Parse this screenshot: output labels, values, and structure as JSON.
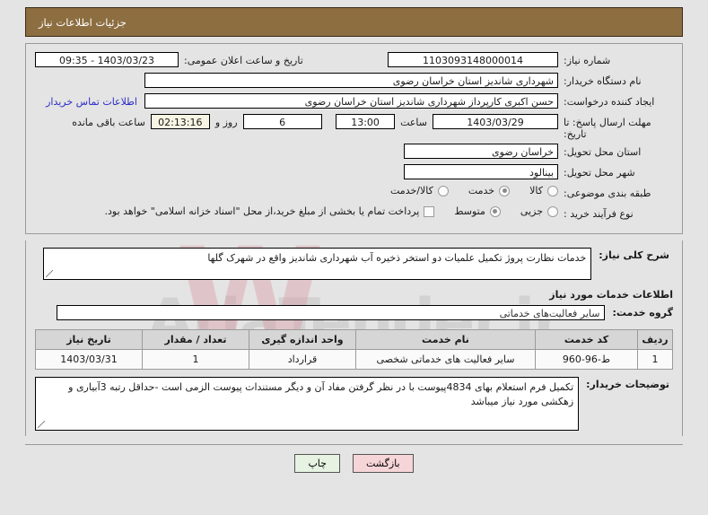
{
  "header": {
    "title": "جزئیات اطلاعات نیاز",
    "bar_color": "#8d6e41"
  },
  "watermark": {
    "text": "AriaTender.ir",
    "mark": "W"
  },
  "form": {
    "need_number": {
      "label": "شماره نیاز:",
      "value": "1103093148000014"
    },
    "public_announce": {
      "label": "تاریخ و ساعت اعلان عمومی:",
      "value": "1403/03/23 - 09:35"
    },
    "buyer_org": {
      "label": "نام دستگاه خریدار:",
      "value": "شهرداری شاندیز استان خراسان رضوی"
    },
    "requester": {
      "label": "ایجاد کننده درخواست:",
      "value": "حسن اکبری کارپرداز شهرداری شاندیز استان خراسان رضوی"
    },
    "contact_link": "اطلاعات تماس خریدار",
    "deadline": {
      "label": "مهلت ارسال پاسخ: تا تاریخ:",
      "date": "1403/03/29",
      "time_label": "ساعت",
      "time": "13:00",
      "days": "6",
      "days_sep": "روز و",
      "countdown": "02:13:16",
      "remaining_label": "ساعت باقی مانده"
    },
    "province": {
      "label": "استان محل تحویل:",
      "value": "خراسان رضوی"
    },
    "city": {
      "label": "شهر محل تحویل:",
      "value": "بینالود"
    },
    "classification": {
      "label": "طبقه بندی موضوعی:",
      "options": [
        {
          "label": "کالا",
          "selected": false
        },
        {
          "label": "خدمت",
          "selected": true
        },
        {
          "label": "کالا/خدمت",
          "selected": false
        }
      ]
    },
    "process_type": {
      "label": "نوع فرآیند خرید :",
      "options": [
        {
          "label": "جزیی",
          "selected": false
        },
        {
          "label": "متوسط",
          "selected": true
        }
      ],
      "checkbox_checked": false,
      "payment_note": "پرداخت تمام یا بخشی از مبلغ خرید،از محل \"اسناد خزانه اسلامی\" خواهد بود."
    }
  },
  "need_description": {
    "label": "شرح کلی نیاز:",
    "value": "خدمات نظارت پروژ تکمیل علمیات دو استخر  ذخیره آب شهرداری شاندیز واقع در شهرک گلها"
  },
  "services_section": {
    "heading": "اطلاعات خدمات مورد نیاز",
    "service_group": {
      "label": "گروه خدمت:",
      "value": "سایر فعالیت‌های خدماتی"
    }
  },
  "items_table": {
    "columns": [
      "ردیف",
      "کد خدمت",
      "نام خدمت",
      "واحد اندازه گیری",
      "تعداد / مقدار",
      "تاریخ نیاز"
    ],
    "rows": [
      {
        "row": "1",
        "code": "ط-96-960",
        "name": "سایر فعالیت های خدماتی شخصی",
        "unit": "قرارداد",
        "qty": "1",
        "date": "1403/03/31"
      }
    ]
  },
  "buyer_notes": {
    "label": "توضیحات خریدار:",
    "value": "تکمیل فرم استعلام بهای 4834پیوست با در نظر گرفتن مفاد آن و دیگر مستندات پیوست الزمی است -حداقل رتبه 3آبیاری و زهکشی مورد نیاز میباشد"
  },
  "footer": {
    "back_button": "بازگشت",
    "print_button": "چاپ"
  }
}
